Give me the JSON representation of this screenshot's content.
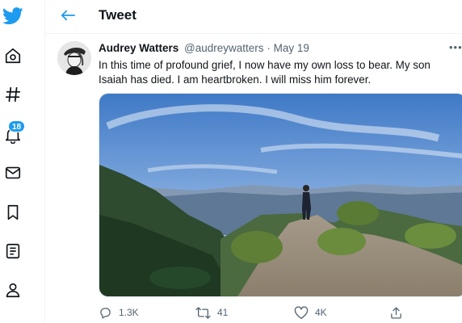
{
  "nav": {
    "items": [
      {
        "icon": "twitter-logo-icon"
      },
      {
        "icon": "home-icon"
      },
      {
        "icon": "explore-hashtag-icon"
      },
      {
        "icon": "notifications-bell-icon",
        "badge": "18"
      },
      {
        "icon": "messages-envelope-icon"
      },
      {
        "icon": "bookmarks-icon"
      },
      {
        "icon": "lists-icon"
      },
      {
        "icon": "profile-icon"
      }
    ]
  },
  "header": {
    "title": "Tweet"
  },
  "tweet": {
    "author_name": "Audrey Watters",
    "author_handle": "@audreywatters",
    "separator": "·",
    "date": "May 19",
    "text": "In this time of profound grief, I now have my own loss to bear. My son Isaiah has died. I am heartbroken. I will miss him forever.",
    "actions": {
      "replies": "1.3K",
      "retweets": "41",
      "likes": "4K"
    }
  },
  "colors": {
    "accent": "#1d9bf0",
    "secondary_text": "#536471",
    "primary_text": "#0f1419"
  }
}
